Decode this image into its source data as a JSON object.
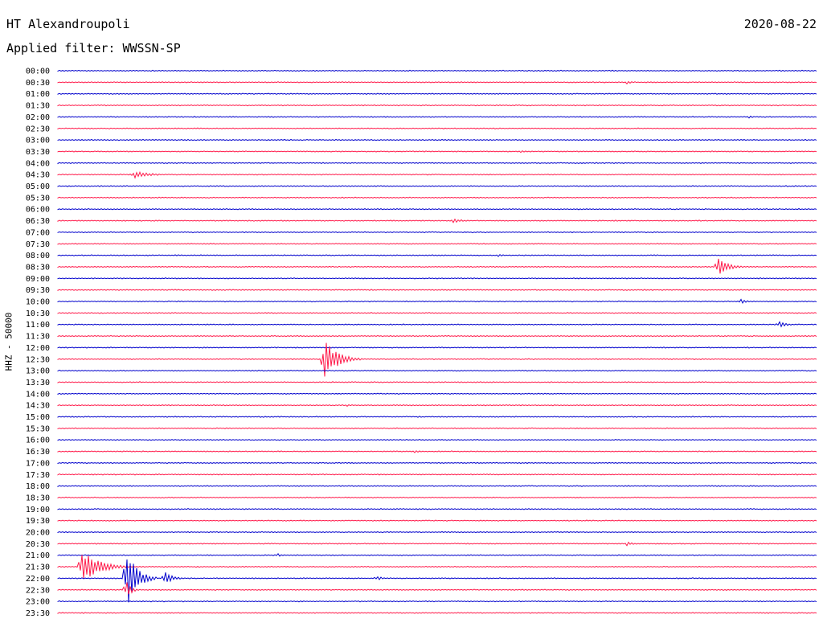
{
  "header": {
    "station": "HT Alexandroupoli",
    "filter": "Applied filter: WWSSN-SP",
    "date": "2020-08-22"
  },
  "channel_label": "HHZ - 50000",
  "colors": {
    "odd_trace": "#0000cc",
    "even_trace": "#ff1a4a",
    "background": "#ffffff"
  },
  "chart_data": {
    "type": "line",
    "title": "",
    "xlabel": "",
    "ylabel": "HHZ - 50000",
    "grid": false,
    "row_labels": [
      "00:00",
      "00:30",
      "01:00",
      "01:30",
      "02:00",
      "02:30",
      "03:00",
      "03:30",
      "04:00",
      "04:30",
      "05:00",
      "05:30",
      "06:00",
      "06:30",
      "07:00",
      "07:30",
      "08:00",
      "08:30",
      "09:00",
      "09:30",
      "10:00",
      "10:30",
      "11:00",
      "11:30",
      "12:00",
      "12:30",
      "13:00",
      "13:30",
      "14:00",
      "14:30",
      "15:00",
      "15:30",
      "16:00",
      "16:30",
      "17:00",
      "17:30",
      "18:00",
      "18:30",
      "19:00",
      "19:30",
      "20:00",
      "20:30",
      "21:00",
      "21:30",
      "22:00",
      "22:30",
      "23:00",
      "23:30"
    ],
    "trace_colors_alternate": [
      "#0000cc",
      "#ff1a4a"
    ],
    "events": [
      {
        "row": "00:30",
        "at": 0.75,
        "amplitude": 2,
        "duration": 0.03
      },
      {
        "row": "02:00",
        "at": 0.91,
        "amplitude": 2,
        "duration": 0.02
      },
      {
        "row": "03:30",
        "at": 0.61,
        "amplitude": 2,
        "duration": 0.02
      },
      {
        "row": "04:30",
        "at": 0.1,
        "amplitude": 5,
        "duration": 0.06
      },
      {
        "row": "06:30",
        "at": 0.52,
        "amplitude": 3,
        "duration": 0.04
      },
      {
        "row": "08:00",
        "at": 0.58,
        "amplitude": 2,
        "duration": 0.02
      },
      {
        "row": "08:30",
        "at": 0.87,
        "amplitude": 12,
        "duration": 0.04
      },
      {
        "row": "10:00",
        "at": 0.9,
        "amplitude": 3,
        "duration": 0.03
      },
      {
        "row": "11:00",
        "at": 0.95,
        "amplitude": 4,
        "duration": 0.03
      },
      {
        "row": "12:30",
        "at": 0.35,
        "amplitude": 28,
        "duration": 0.05
      },
      {
        "row": "14:30",
        "at": 0.38,
        "amplitude": 2,
        "duration": 0.02
      },
      {
        "row": "16:30",
        "at": 0.47,
        "amplitude": 2,
        "duration": 0.02
      },
      {
        "row": "20:30",
        "at": 0.75,
        "amplitude": 3,
        "duration": 0.02
      },
      {
        "row": "21:00",
        "at": 0.29,
        "amplitude": 2,
        "duration": 0.02
      },
      {
        "row": "21:30",
        "at": 0.03,
        "amplitude": 22,
        "duration": 0.07
      },
      {
        "row": "22:00",
        "at": 0.09,
        "amplitude": 40,
        "duration": 0.04
      },
      {
        "row": "22:00",
        "at": 0.14,
        "amplitude": 9,
        "duration": 0.03
      },
      {
        "row": "22:00",
        "at": 0.42,
        "amplitude": 4,
        "duration": 0.02
      },
      {
        "row": "22:30",
        "at": 0.09,
        "amplitude": 12,
        "duration": 0.02
      }
    ]
  }
}
